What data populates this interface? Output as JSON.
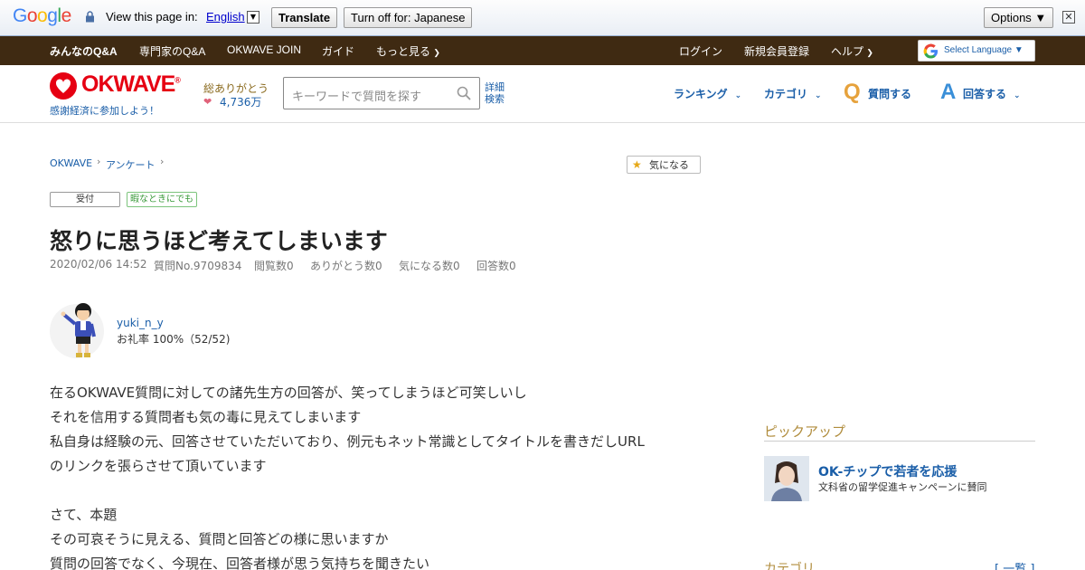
{
  "translate_bar": {
    "logo_letters": [
      {
        "ch": "G",
        "color": "#4285f4"
      },
      {
        "ch": "o",
        "color": "#ea4335"
      },
      {
        "ch": "o",
        "color": "#fbbc05"
      },
      {
        "ch": "g",
        "color": "#4285f4"
      },
      {
        "ch": "l",
        "color": "#34a853"
      },
      {
        "ch": "e",
        "color": "#ea4335"
      }
    ],
    "view_text": "View this page in:",
    "language": "English",
    "translate_label": "Translate",
    "turn_off_label": "Turn off for: Japanese",
    "options_label": "Options ▼",
    "close_label": "✕"
  },
  "top_nav": {
    "items": [
      "みんなのQ&A",
      "専門家のQ&A",
      "OKWAVE JOIN",
      "ガイド",
      "もっと見る"
    ],
    "right_items": [
      "ログイン",
      "新規会員登録",
      "ヘルプ"
    ],
    "select_language": "Select Language​ ▼"
  },
  "header": {
    "logo": "OKWAVE",
    "logo_sub": "感謝経済に参加しよう！",
    "thanks_label": "総ありがとう",
    "thanks_count": "4,736万",
    "search_placeholder": "キーワードで質問を探す",
    "advanced_search": [
      "詳細",
      "検索"
    ],
    "nav": [
      "ランキング",
      "カテゴリ",
      "質問する",
      "回答する"
    ]
  },
  "breadcrumb": [
    "OKWAVE",
    "アンケート"
  ],
  "watch_label": "気になる",
  "tags": {
    "status": "受付",
    "free": "暇なときにでも"
  },
  "question": {
    "title": "怒りに思うほど考えてしまいます",
    "meta": [
      "2020/02/06 14:52",
      "質問No.9709834",
      "閲覧数0",
      "ありがとう数0",
      "気になる数0",
      "回答数0"
    ],
    "user": {
      "name": "yuki_n_y",
      "rate": "お礼率 100%（52/52)"
    },
    "body": [
      "在るOKWAVE質問に対しての諸先生方の回答が、笑ってしまうほど可笑しいし",
      "それを信用する質問者も気の毒に見えてしまいます",
      "私自身は経験の元、回答させていただいており、例元もネット常識としてタイトルを書きだしURL",
      "のリンクを張らさせて頂いています",
      "",
      "さて、本題",
      "その可哀そうに見える、質問と回答どの様に思いますか",
      "質問の回答でなく、今現在、回答者様が思う気持ちを聞きたい"
    ]
  },
  "sidebar": {
    "pickup_title": "ピックアップ",
    "pickup_head": "OK-チップで若者を応援",
    "pickup_sub": "文科省の留学促進キャンペーンに賛同",
    "category_title": "カテゴリ",
    "category_all": "[ 一覧 ]"
  }
}
